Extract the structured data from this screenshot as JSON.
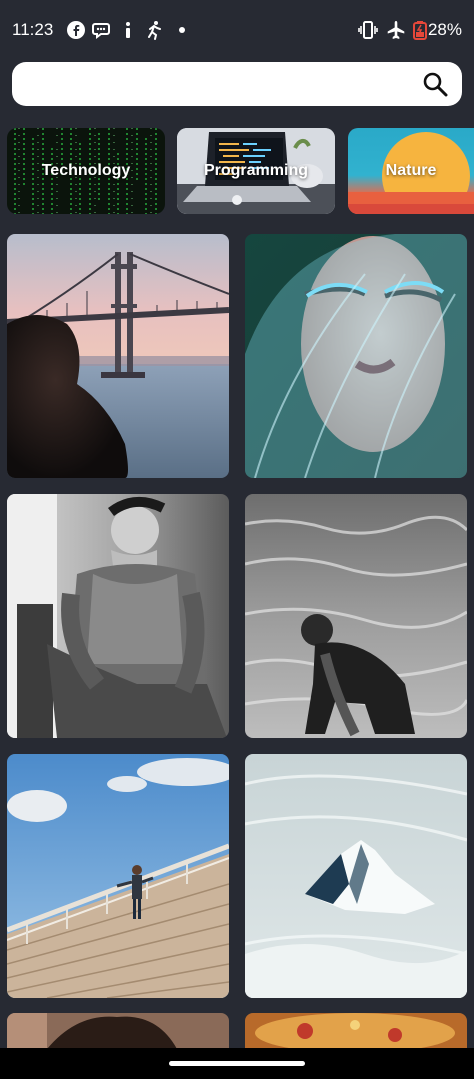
{
  "status_bar": {
    "time": "11:23",
    "battery": "28%",
    "icons": [
      "facebook-icon",
      "chat-icon",
      "info-icon",
      "running-icon",
      "dot-icon",
      "vibrate-icon",
      "airplane-icon",
      "battery-icon"
    ]
  },
  "search": {
    "value": "",
    "placeholder": ""
  },
  "categories": [
    {
      "label": "Technology"
    },
    {
      "label": "Programming"
    },
    {
      "label": "Nature"
    }
  ],
  "colors": {
    "background": "#272a33",
    "search_bg": "#ffffff",
    "battery_low": "#e5483a"
  }
}
